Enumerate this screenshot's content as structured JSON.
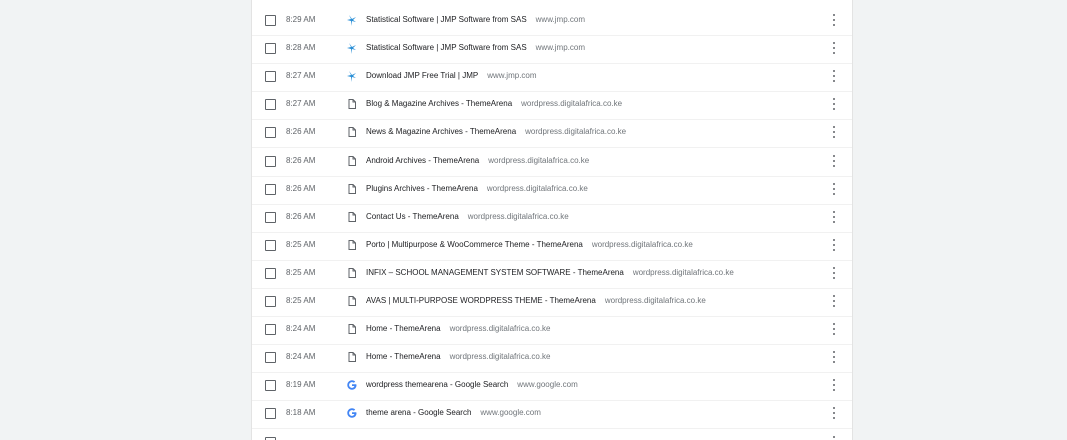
{
  "history": {
    "rows": [
      {
        "time": "8:29 AM",
        "title": "Statistical Software | JMP Software from SAS",
        "domain": "www.jmp.com",
        "icon": "jmp-icon"
      },
      {
        "time": "8:28 AM",
        "title": "Statistical Software | JMP Software from SAS",
        "domain": "www.jmp.com",
        "icon": "jmp-icon"
      },
      {
        "time": "8:27 AM",
        "title": "Download JMP Free Trial | JMP",
        "domain": "www.jmp.com",
        "icon": "jmp-icon"
      },
      {
        "time": "8:27 AM",
        "title": "Blog & Magazine Archives - ThemeArena",
        "domain": "wordpress.digitalafrica.co.ke",
        "icon": "page-icon"
      },
      {
        "time": "8:26 AM",
        "title": "News & Magazine Archives - ThemeArena",
        "domain": "wordpress.digitalafrica.co.ke",
        "icon": "page-icon"
      },
      {
        "time": "8:26 AM",
        "title": "Android Archives - ThemeArena",
        "domain": "wordpress.digitalafrica.co.ke",
        "icon": "page-icon"
      },
      {
        "time": "8:26 AM",
        "title": "Plugins Archives - ThemeArena",
        "domain": "wordpress.digitalafrica.co.ke",
        "icon": "page-icon"
      },
      {
        "time": "8:26 AM",
        "title": "Contact Us - ThemeArena",
        "domain": "wordpress.digitalafrica.co.ke",
        "icon": "page-icon"
      },
      {
        "time": "8:25 AM",
        "title": "Porto | Multipurpose & WooCommerce Theme - ThemeArena",
        "domain": "wordpress.digitalafrica.co.ke",
        "icon": "page-icon"
      },
      {
        "time": "8:25 AM",
        "title": "INFIX – SCHOOL MANAGEMENT SYSTEM SOFTWARE - ThemeArena",
        "domain": "wordpress.digitalafrica.co.ke",
        "icon": "page-icon"
      },
      {
        "time": "8:25 AM",
        "title": "AVAS | MULTI-PURPOSE WORDPRESS THEME - ThemeArena",
        "domain": "wordpress.digitalafrica.co.ke",
        "icon": "page-icon"
      },
      {
        "time": "8:24 AM",
        "title": "Home - ThemeArena",
        "domain": "wordpress.digitalafrica.co.ke",
        "icon": "page-icon"
      },
      {
        "time": "8:24 AM",
        "title": "Home - ThemeArena",
        "domain": "wordpress.digitalafrica.co.ke",
        "icon": "page-icon"
      },
      {
        "time": "8:19 AM",
        "title": "wordpress themearena - Google Search",
        "domain": "www.google.com",
        "icon": "google-icon"
      },
      {
        "time": "8:18 AM",
        "title": "theme arena - Google Search",
        "domain": "www.google.com",
        "icon": "google-icon"
      }
    ]
  },
  "colors": {
    "background": "#f1f3f4",
    "card": "#ffffff",
    "jmp_icon": "#2a8fd6",
    "google_blue": "#4285f4"
  }
}
